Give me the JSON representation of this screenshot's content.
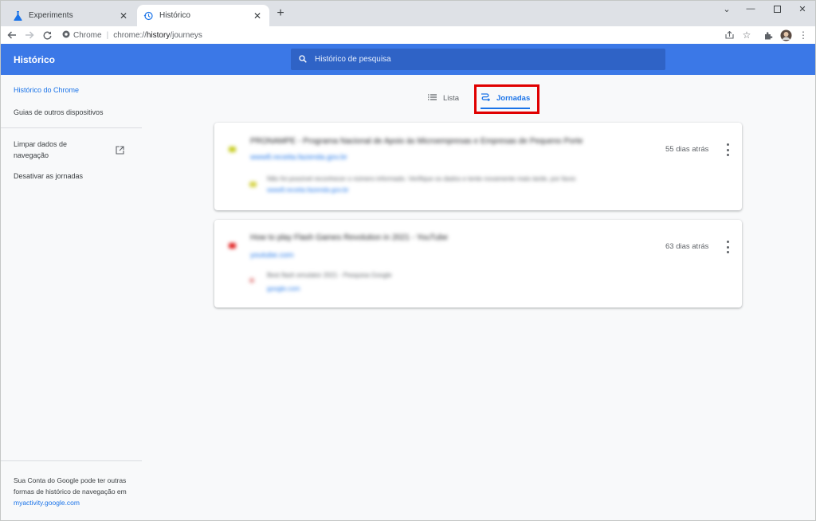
{
  "browser": {
    "tabs": [
      {
        "title": "Experiments",
        "favicon": "flask-icon"
      },
      {
        "title": "Histórico",
        "favicon": "history-icon"
      }
    ],
    "address": {
      "site_label": "Chrome",
      "url_prefix": "chrome://",
      "url_host": "history",
      "url_path": "/journeys"
    }
  },
  "header": {
    "title": "Histórico",
    "search_placeholder": "Histórico de pesquisa"
  },
  "sidebar": {
    "items": [
      {
        "label": "Histórico do Chrome"
      },
      {
        "label": "Guias de outros dispositivos"
      },
      {
        "label": "Limpar dados de navegação"
      },
      {
        "label": "Desativar as jornadas"
      }
    ],
    "footer_text": "Sua Conta do Google pode ter outras formas de histórico de navegação em ",
    "footer_link": "myactivity.google.com"
  },
  "view_tabs": {
    "list": "Lista",
    "journeys": "Jornadas"
  },
  "clusters": [
    {
      "title": "PRONAMPE - Programa Nacional de Apoio às Microempresas e Empresas de Pequeno Porte",
      "url": "www8.receita.fazenda.gov.br",
      "time": "55 dias atrás",
      "visit_title": "Não foi possível reconhecer o número informado. Verifique os dados e tente novamente mais tarde, por favor.",
      "visit_url": "www8.receita.fazenda.gov.br"
    },
    {
      "title": "How to play Flash Games Revolution in 2021 - YouTube",
      "url": "youtube.com",
      "time": "63 dias atrás",
      "visit_title": "Best flash emulator 2021 - Pesquisa Google",
      "visit_url": "google.com"
    }
  ],
  "colors": {
    "header_bg": "#3b78e7",
    "accent": "#1a73e8",
    "highlight_box": "#e00000"
  }
}
